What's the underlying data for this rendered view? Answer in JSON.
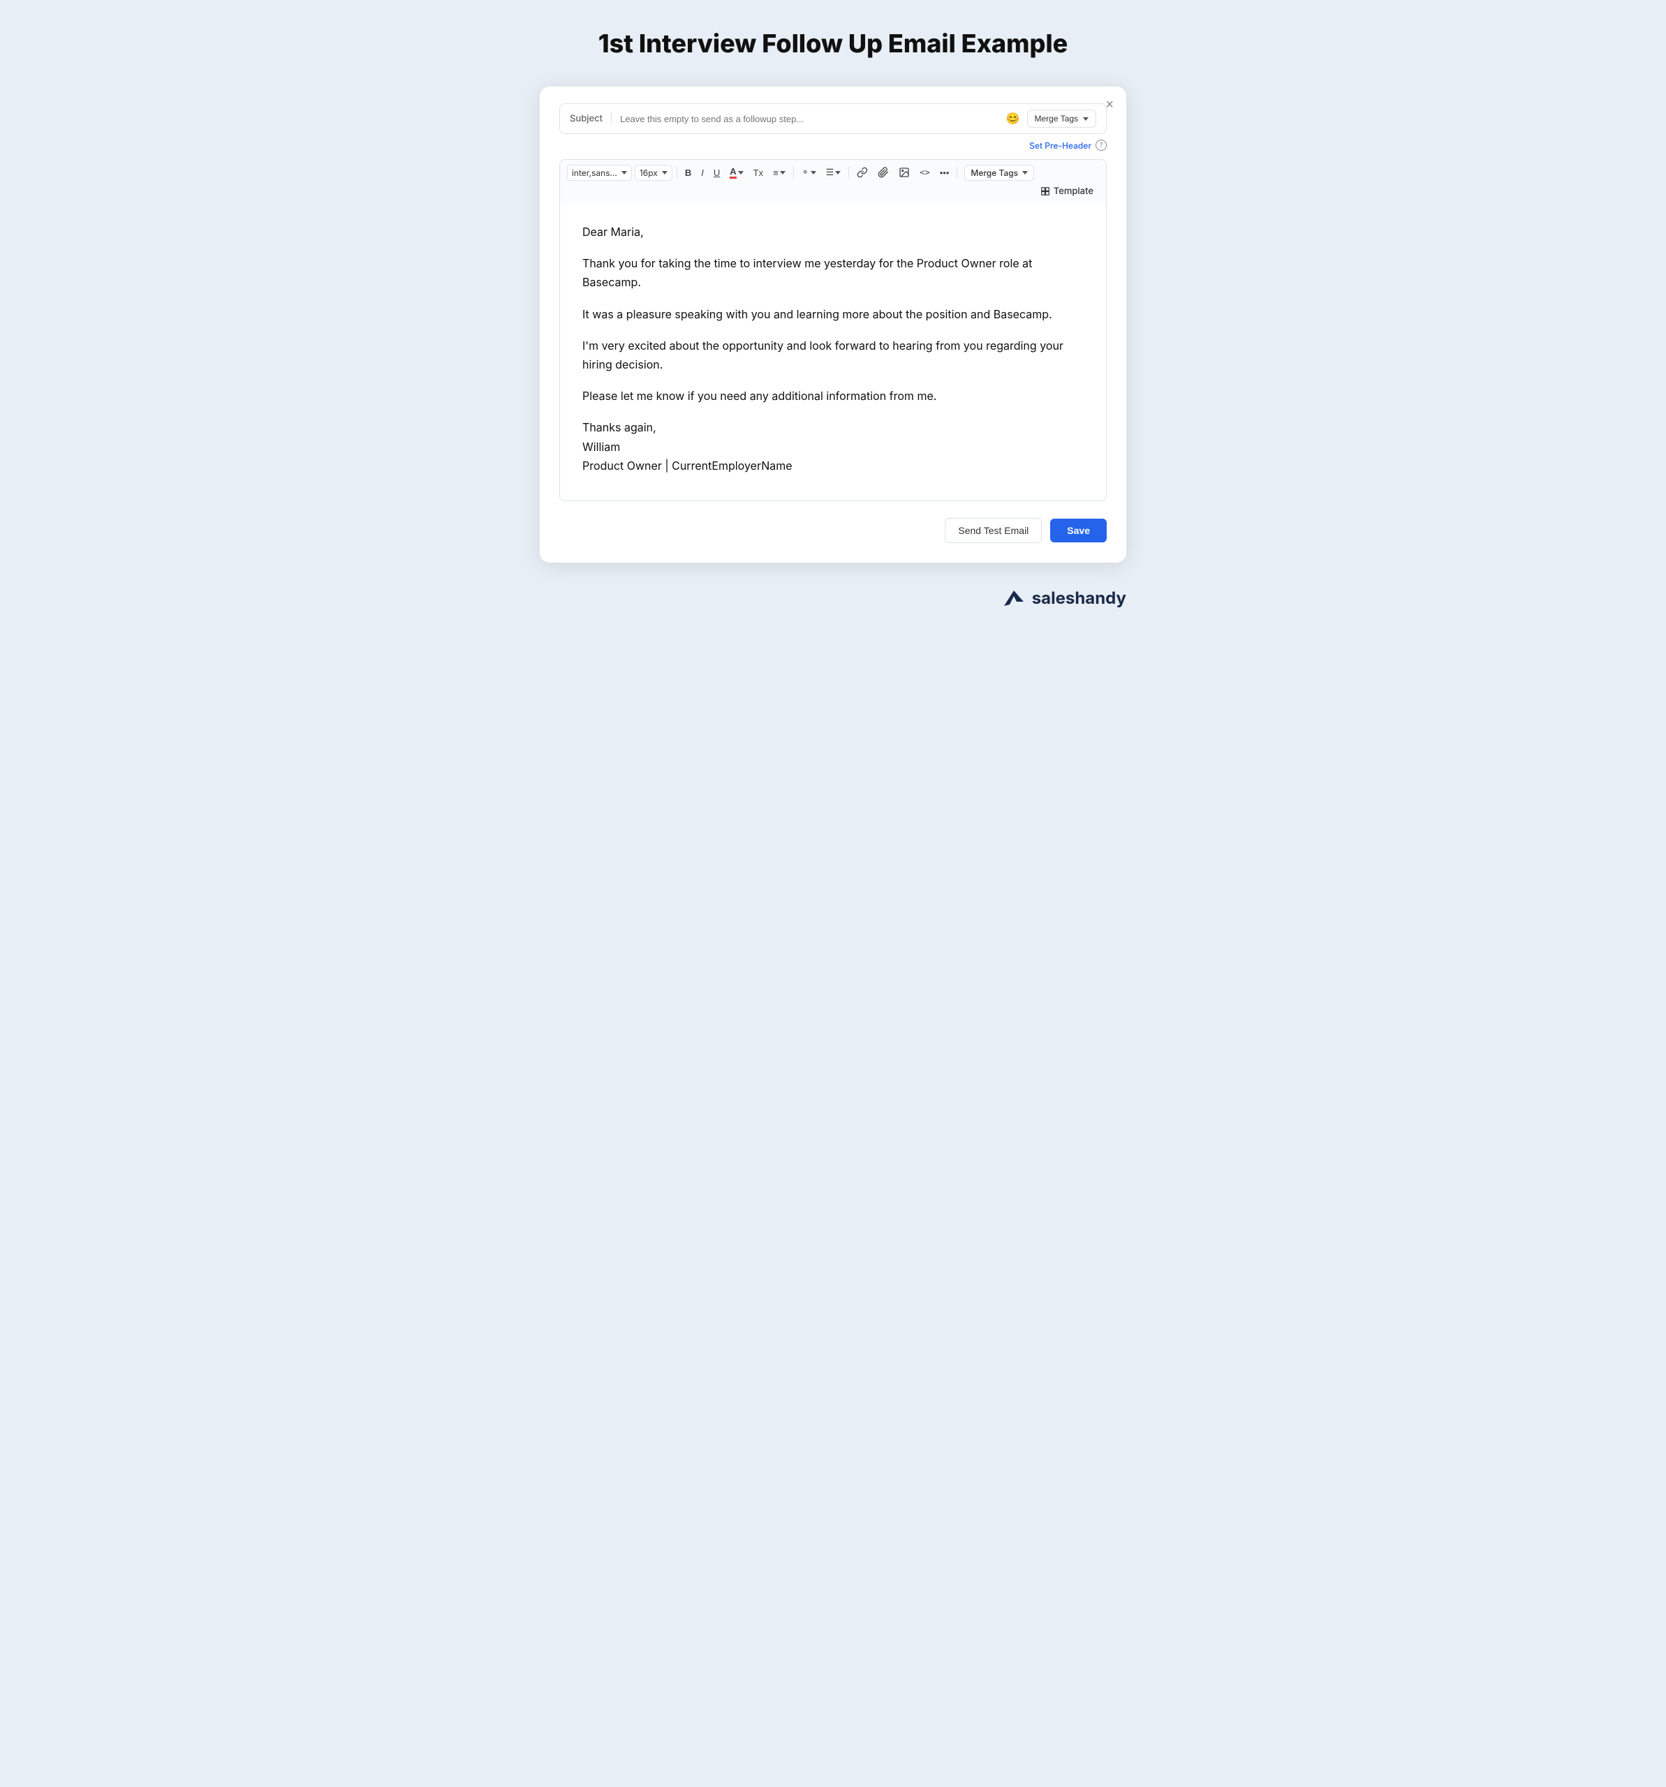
{
  "page": {
    "title": "1st Interview Follow Up Email Example",
    "background_color": "#e8eef5"
  },
  "modal": {
    "close_label": "×",
    "subject": {
      "label": "Subject",
      "placeholder": "Leave this empty to send as a followup step...",
      "emoji_icon": "😊",
      "merge_tags_label": "Merge Tags",
      "chevron": "▾"
    },
    "pre_header": {
      "link_label": "Set Pre-Header",
      "help_icon": "?"
    },
    "toolbar": {
      "font_family": "inter,sans...",
      "font_size": "16px",
      "bold": "B",
      "italic": "I",
      "underline": "U",
      "color": "A",
      "strikethrough": "Tx",
      "align": "≡",
      "list_ordered": "⚬",
      "list_unordered": "☰",
      "link": "🔗",
      "attachment": "📎",
      "image": "🖼",
      "code": "<>",
      "more": "•••",
      "merge_tags_label": "Merge Tags",
      "merge_tags_chevron": "▾",
      "template_icon": "⧉",
      "template_label": "Template"
    },
    "email_body": {
      "greeting": "Dear Maria,",
      "paragraph1": "Thank you for taking the time to interview me yesterday for the Product Owner role at Basecamp.",
      "paragraph2": "It was a pleasure speaking with you and learning more about the position and Basecamp.",
      "paragraph3": "I'm very excited about the opportunity and look forward to hearing from you regarding your hiring decision.",
      "paragraph4": "Please let me know if you need any additional information from me.",
      "closing": "Thanks again,",
      "name": "William",
      "signature": "Product Owner | CurrentEmployerName"
    },
    "footer": {
      "send_test_label": "Send Test Email",
      "save_label": "Save"
    }
  },
  "brand": {
    "name": "saleshandy"
  }
}
